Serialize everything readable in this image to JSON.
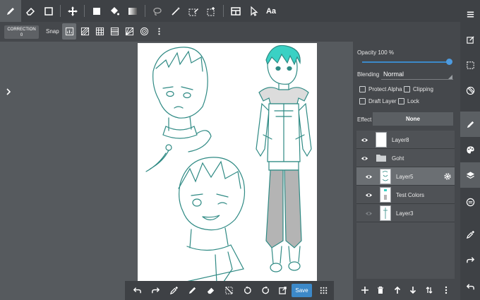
{
  "toolbar": {
    "tools": [
      "pen-icon",
      "eraser-icon",
      "select-rect-icon",
      "move-icon",
      "fill-rect-icon",
      "bucket-icon",
      "gradient-icon",
      "lasso-icon",
      "magic-wand-icon",
      "select-pen-icon",
      "select-eraser-icon",
      "panel-icon",
      "pointer-icon",
      "text-icon"
    ],
    "text_tool_label": "Aa"
  },
  "subbar": {
    "correction_label": "CORRECTION",
    "correction_value": "0",
    "snap_label": "Snap"
  },
  "panel": {
    "opacity_label": "Opacity 100 %",
    "opacity_value": 100,
    "blending_label": "Blending",
    "blending_value": "Normal",
    "protect_alpha": "Protect Alpha",
    "clipping": "Clipping",
    "draft_layer": "Draft Layer",
    "lock": "Lock",
    "effect_label": "Effect",
    "effect_value": "None",
    "layers": [
      {
        "name": "Layer8",
        "type": "layer",
        "visible": true,
        "selected": false
      },
      {
        "name": "Goht",
        "type": "folder",
        "visible": true,
        "selected": false
      },
      {
        "name": "Layer5",
        "type": "layer",
        "visible": true,
        "selected": true
      },
      {
        "name": "Test Colors",
        "type": "layer",
        "visible": true,
        "selected": false
      },
      {
        "name": "Layer3",
        "type": "layer",
        "visible": false,
        "selected": false
      }
    ]
  },
  "bottombar": {
    "save_label": "Save"
  },
  "colors": {
    "accent": "#3c89c9",
    "toolbar_bg": "#3e4145",
    "canvas_bg": "#565a5e",
    "line_art": "#2f8a84",
    "hair": "#3ad1c4"
  }
}
